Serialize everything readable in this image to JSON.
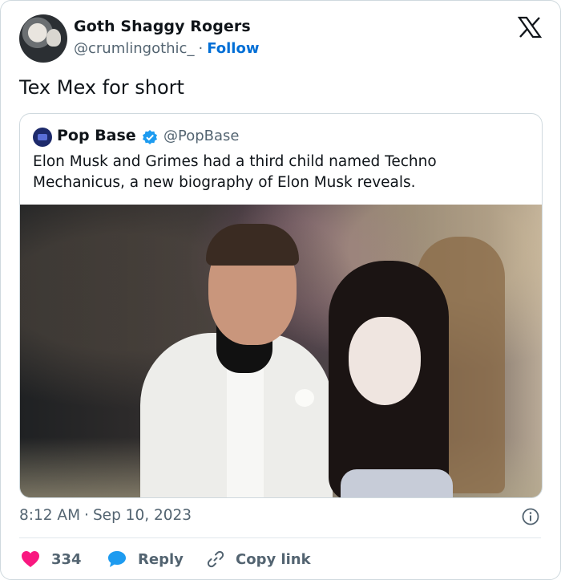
{
  "author": {
    "name": "Goth Shaggy Rogers",
    "handle": "@crumlingothic_",
    "separator": "·",
    "follow_label": "Follow"
  },
  "tweet": {
    "text": "Tex Mex for short"
  },
  "quoted": {
    "name": "Pop Base",
    "handle": "@PopBase",
    "text": "Elon Musk and Grimes had a third child named Techno Mechanicus, a new biography of Elon Musk reveals."
  },
  "meta": {
    "time": "8:12 AM",
    "separator": "·",
    "date": "Sep 10, 2023"
  },
  "actions": {
    "likes": "334",
    "reply_label": "Reply",
    "copy_label": "Copy link"
  },
  "icons": {
    "logo": "x-logo-icon",
    "verified": "verified-badge-icon",
    "info": "info-icon",
    "like": "heart-icon",
    "reply": "speech-bubble-icon",
    "copy": "link-icon"
  },
  "colors": {
    "text": "#0f1419",
    "muted": "#536471",
    "link": "#006fd6",
    "verified": "#1d9bf0",
    "heart": "#f91880",
    "reply": "#1d9bf0",
    "border": "#cfd9de"
  }
}
